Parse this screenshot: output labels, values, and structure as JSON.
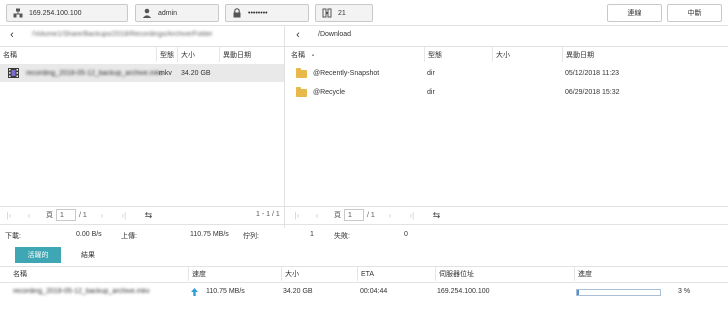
{
  "toolbar": {
    "host": "169.254.100.100",
    "user": "admin",
    "password": "••••••••",
    "port": "21",
    "continue_label": "連線",
    "abort_label": "中斷"
  },
  "left_pane": {
    "path": "/Volume1/Share/Backups/2018/Recordings/Archive/Folder",
    "columns": [
      "名稱",
      "型態",
      "大小",
      "異動日期"
    ],
    "rows": [
      {
        "name": "recording_2018-05-12_backup_archive.mkv",
        "type": "mkv",
        "size": "34.20 GB",
        "date": ""
      }
    ],
    "pager": {
      "page_label": "頁",
      "page": "1",
      "total": "/ 1",
      "range": "1 - 1 / 1"
    }
  },
  "right_pane": {
    "path": "/Download",
    "columns": [
      "名稱",
      "型態",
      "大小",
      "異動日期"
    ],
    "sort_indicator": "▲",
    "rows": [
      {
        "name": "@Recently-Snapshot",
        "type": "dir",
        "size": "",
        "date": "05/12/2018 11:23"
      },
      {
        "name": "@Recycle",
        "type": "dir",
        "size": "",
        "date": "06/29/2018 15:32"
      }
    ],
    "pager": {
      "page_label": "頁",
      "page": "1",
      "total": "/ 1"
    }
  },
  "status": {
    "download_label": "下載:",
    "download_value": "0.00 B/s",
    "upload_label": "上傳:",
    "upload_value": "110.75 MB/s",
    "queue_label": "佇列:",
    "queue_value": "1",
    "failed_label": "失敗:",
    "failed_value": "0"
  },
  "tabs": {
    "active": "活躍的",
    "result": "結果"
  },
  "transfers": {
    "columns": [
      "名稱",
      "速度",
      "大小",
      "ETA",
      "伺服器位址",
      "進度"
    ],
    "rows": [
      {
        "name": "recording_2018-05-12_backup_archive.mkv",
        "speed": "110.75 MB/s",
        "size": "34.20 GB",
        "eta": "00:04:44",
        "server": "169.254.100.100",
        "progress_text": "3 %",
        "progress_value": 0.03
      }
    ]
  },
  "colors": {
    "accent": "#3fa7b3",
    "selected_row": "#e9e9e9",
    "progress_fill": "#4f8fd0",
    "upload_arrow": "#2d9fd8"
  }
}
